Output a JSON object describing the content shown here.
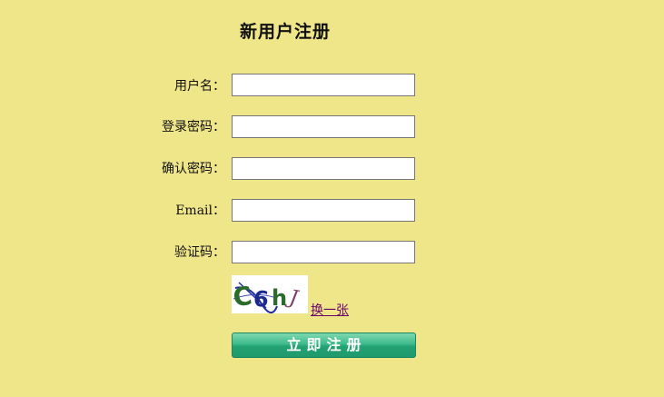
{
  "form": {
    "title": "新用户注册",
    "fields": [
      {
        "label": "用户名：",
        "value": ""
      },
      {
        "label": "登录密码：",
        "value": ""
      },
      {
        "label": "确认密码：",
        "value": ""
      },
      {
        "label": "Email：",
        "value": ""
      },
      {
        "label": "验证码：",
        "value": ""
      }
    ],
    "captcha_text": "C6hJ",
    "change_captcha_label": "换一张",
    "submit_label": "立即注册"
  },
  "colors": {
    "background": "#efe689",
    "button": "#2faa7c",
    "link": "#6b006b"
  }
}
